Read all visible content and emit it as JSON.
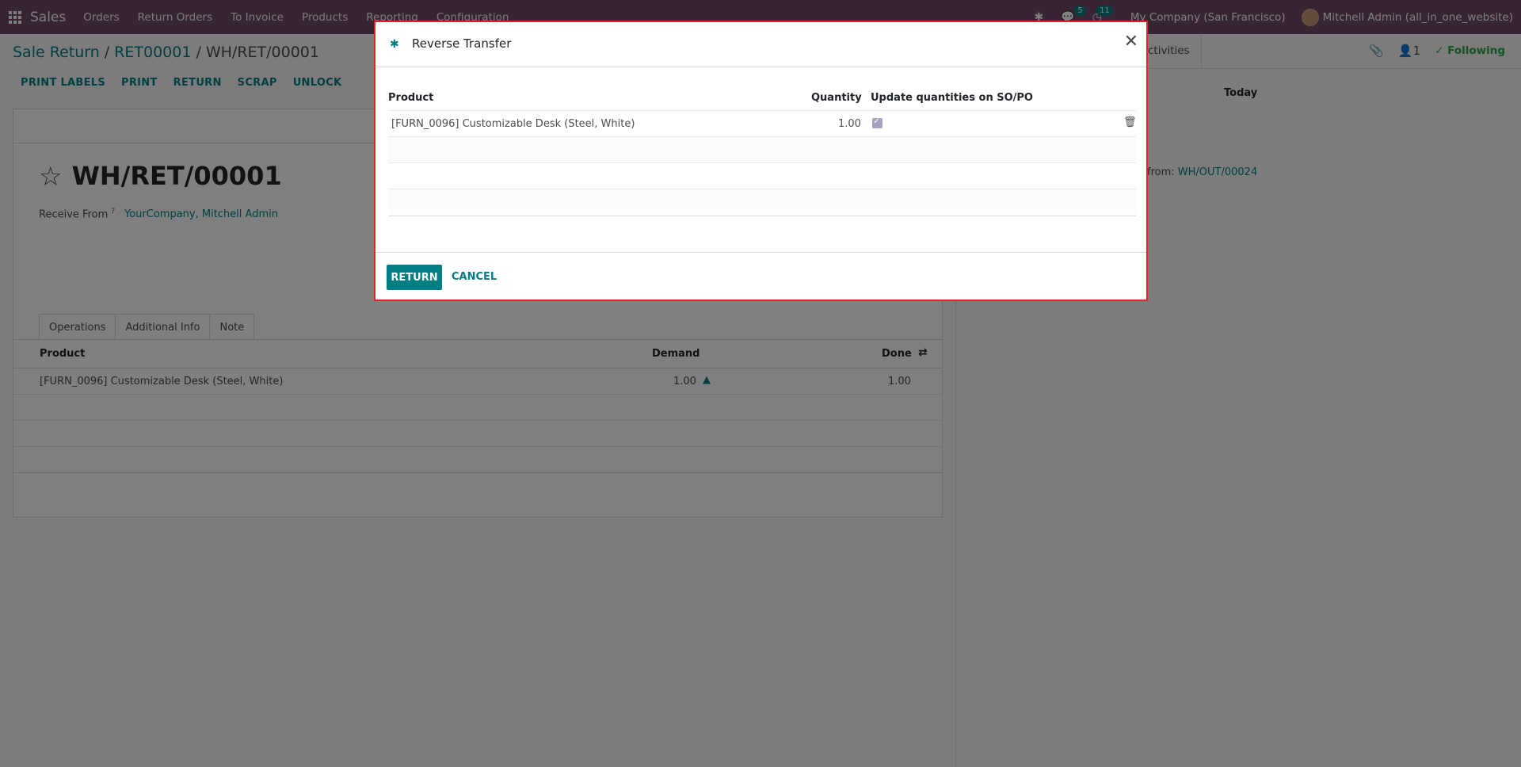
{
  "navbar": {
    "app_name": "Sales",
    "menu": [
      "Orders",
      "Return Orders",
      "To Invoice",
      "Products",
      "Reporting",
      "Configuration"
    ],
    "messages_count": "5",
    "activities_count": "11",
    "company": "My Company (San Francisco)",
    "user": "Mitchell Admin (all_in_one_website)"
  },
  "breadcrumb": {
    "items": [
      "Sale Return",
      "RET00001"
    ],
    "current": "WH/RET/00001"
  },
  "actions": [
    "PRINT LABELS",
    "PRINT",
    "RETURN",
    "SCRAP",
    "UNLOCK"
  ],
  "chatter": {
    "activities_label": "Activities",
    "followers_count": "1",
    "following_label": "Following",
    "today_label": "Today",
    "created_from_label": "from:",
    "created_from_link": "WH/OUT/00024"
  },
  "record": {
    "title": "WH/RET/00001",
    "receive_from_label": "Receive From",
    "receive_from_help": "?",
    "receive_from_value": "YourCompany, Mitchell Admin"
  },
  "tabs": [
    "Operations",
    "Additional Info",
    "Note"
  ],
  "operations": {
    "headers": {
      "product": "Product",
      "demand": "Demand",
      "done": "Done"
    },
    "rows": [
      {
        "product": "[FURN_0096] Customizable Desk (Steel, White)",
        "demand": "1.00",
        "done": "1.00"
      }
    ]
  },
  "modal": {
    "title": "Reverse Transfer",
    "headers": {
      "product": "Product",
      "quantity": "Quantity",
      "update": "Update quantities on SO/PO"
    },
    "rows": [
      {
        "product": "[FURN_0096] Customizable Desk (Steel, White)",
        "quantity": "1.00",
        "update": true
      }
    ],
    "return_label": "RETURN",
    "cancel_label": "CANCEL"
  },
  "colors": {
    "navbar": "#714b67",
    "accent": "#017e84",
    "modal_border": "#e0242c"
  }
}
